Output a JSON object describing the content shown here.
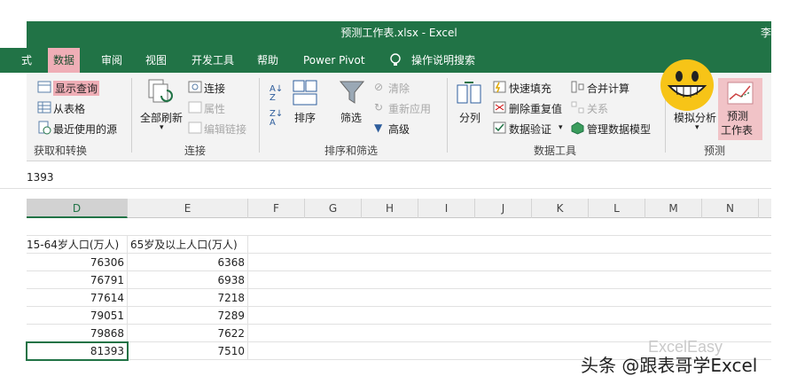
{
  "window": {
    "title": "预测工作表.xlsx  -  Excel",
    "user": "李"
  },
  "tabs": [
    {
      "label": "式"
    },
    {
      "label": "数据"
    },
    {
      "label": "审阅"
    },
    {
      "label": "视图"
    },
    {
      "label": "开发工具"
    },
    {
      "label": "帮助"
    },
    {
      "label": "Power Pivot"
    },
    {
      "label": "操作说明搜索"
    }
  ],
  "ribbon": {
    "get_transform": {
      "show_query": "显示查询",
      "from_table": "从表格",
      "recent_sources": "最近使用的源",
      "group": "获取和转换"
    },
    "connections": {
      "refresh_all": "全部刷新",
      "connections": "连接",
      "properties": "属性",
      "edit_links": "编辑链接",
      "group": "连接"
    },
    "sort_filter": {
      "sort": "排序",
      "filter": "筛选",
      "clear": "清除",
      "reapply": "重新应用",
      "advanced": "高级",
      "group": "排序和筛选"
    },
    "data_tools": {
      "text_to_columns": "分列",
      "flash_fill": "快速填充",
      "remove_duplicates": "删除重复值",
      "data_validation": "数据验证",
      "consolidate": "合并计算",
      "relationships": "关系",
      "manage_model": "管理数据模型",
      "group": "数据工具"
    },
    "forecast": {
      "what_if": "模拟分析",
      "forecast_sheet_line1": "预测",
      "forecast_sheet_line2": "工作表",
      "group": "预测"
    }
  },
  "formula_bar": {
    "value": "1393"
  },
  "columns": [
    "D",
    "E",
    "F",
    "G",
    "H",
    "I",
    "J",
    "K",
    "L",
    "M",
    "N"
  ],
  "headers": {
    "d": "15-64岁人口(万人)",
    "e": "65岁及以上人口(万人)"
  },
  "rows": [
    {
      "d": "76306",
      "e": "6368"
    },
    {
      "d": "76791",
      "e": "6938"
    },
    {
      "d": "77614",
      "e": "7218"
    },
    {
      "d": "79051",
      "e": "7289"
    },
    {
      "d": "79868",
      "e": "7622"
    },
    {
      "d": "81393",
      "e": "7510"
    }
  ],
  "watermark": "ExcelEasy",
  "caption": "头条 @跟表哥学Excel",
  "colors": {
    "excel_green": "#217346",
    "highlight_pink": "#efaeb6"
  }
}
